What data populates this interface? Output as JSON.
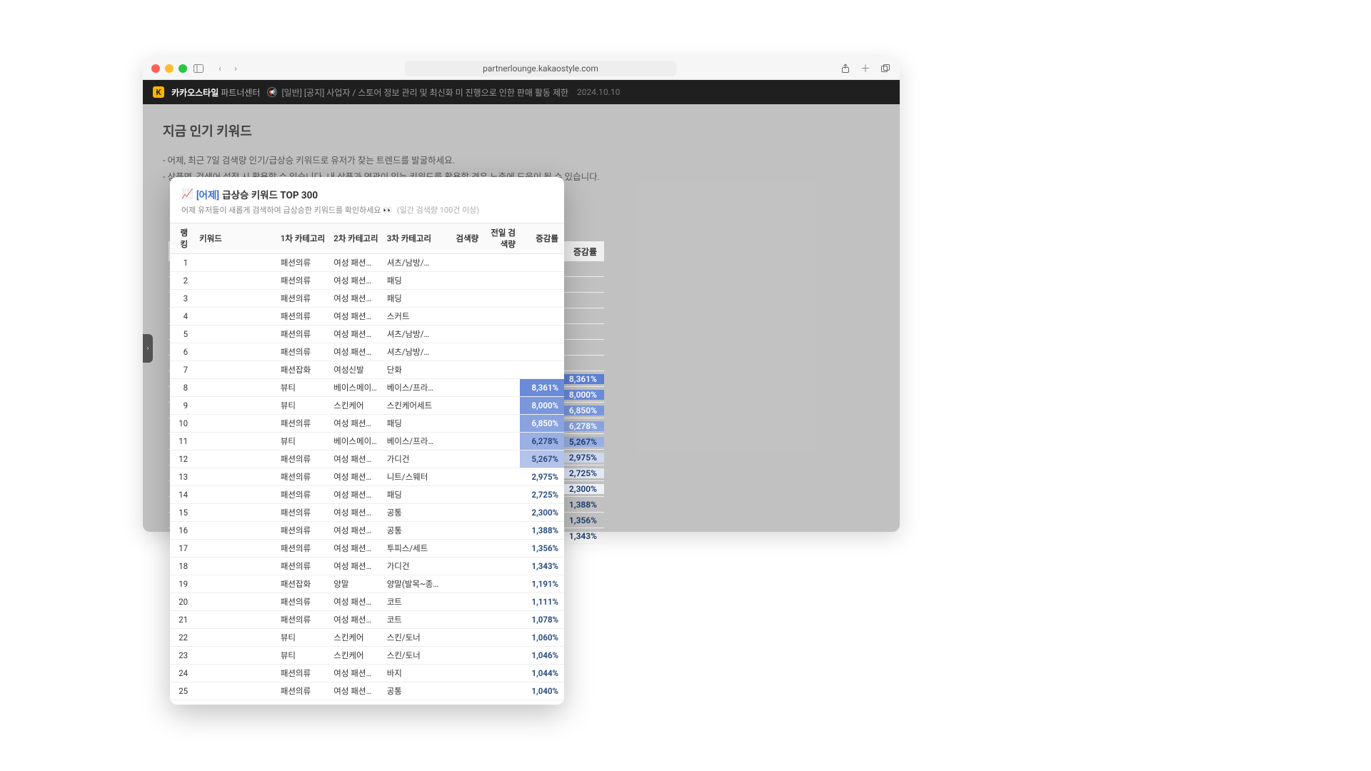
{
  "browser": {
    "url": "partnerlounge.kakaostyle.com"
  },
  "header": {
    "brand": "카카오스타일",
    "brand_sub": "파트너센터",
    "notice": "[일반] [공지] 사업자 / 스토어 정보 관리 및 최신화 미 진행으로 인한 판매 활동 제한",
    "date": "2024.10.10"
  },
  "page": {
    "title": "지금 인기 키워드",
    "help1": "- 어제, 최근 7일 검색량 인기/급상승 키워드로 유저가 찾는 트렌드를 발굴하세요.",
    "help2": "- 상품명, 검색어 설정 시 활용할 수 있습니다. 내 상품과 연관이 있는 키워드를 활용할 경우 노출에 도움이 될 수 있습니다."
  },
  "bg_table": {
    "header_change": "증감률",
    "rows": [
      {
        "pct": "8,361%",
        "cls": "pct-bg-1"
      },
      {
        "pct": "8,000%",
        "cls": "pct-bg-2"
      },
      {
        "pct": "6,850%",
        "cls": "pct-bg-3"
      },
      {
        "pct": "6,278%",
        "cls": "pct-bg-4"
      },
      {
        "pct": "5,267%",
        "cls": "pct-bg-5"
      },
      {
        "pct": "2,975%",
        "cls": "pct-bg-6"
      },
      {
        "pct": "2,725%",
        "cls": "pct-bg-7"
      },
      {
        "pct": "2,300%",
        "cls": "pct-bg-8"
      },
      {
        "pct": "1,388%",
        "cls": "pct-none"
      },
      {
        "pct": "1,356%",
        "cls": "pct-none"
      },
      {
        "pct": "1,343%",
        "cls": "pct-none"
      }
    ]
  },
  "popup": {
    "icon": "📈",
    "title_blue": "[어제]",
    "title_rest": "급상승 키워드 TOP 300",
    "subtitle": "어제 유저들이 새롭게 검색하여 급상승한 키워드를 확인하세요 👀",
    "subtitle_gray": "(일간 검색량 100건 이상)",
    "cols": {
      "rank": "랭킹",
      "keyword": "키워드",
      "cat1": "1차 카테고리",
      "cat2": "2차 카테고리",
      "cat3": "3차 카테고리",
      "search": "검색량",
      "prev": "전일 검색량",
      "change": "증감률"
    },
    "rows": [
      {
        "rank": 1,
        "cat1": "패션의류",
        "cat2": "여성 패션의류",
        "cat3": "셔츠/남방/…",
        "pct": "",
        "pcls": ""
      },
      {
        "rank": 2,
        "cat1": "패션의류",
        "cat2": "여성 패션의류",
        "cat3": "패딩",
        "pct": "",
        "pcls": ""
      },
      {
        "rank": 3,
        "cat1": "패션의류",
        "cat2": "여성 패션의류",
        "cat3": "패딩",
        "pct": "",
        "pcls": ""
      },
      {
        "rank": 4,
        "cat1": "패션의류",
        "cat2": "여성 패션의류",
        "cat3": "스커트",
        "pct": "",
        "pcls": ""
      },
      {
        "rank": 5,
        "cat1": "패션의류",
        "cat2": "여성 패션의류",
        "cat3": "셔츠/남방/…",
        "pct": "",
        "pcls": ""
      },
      {
        "rank": 6,
        "cat1": "패션의류",
        "cat2": "여성 패션의류",
        "cat3": "셔츠/남방/…",
        "pct": "",
        "pcls": ""
      },
      {
        "rank": 7,
        "cat1": "패션잡화",
        "cat2": "여성신발",
        "cat3": "단화",
        "pct": "",
        "pcls": ""
      },
      {
        "rank": 8,
        "cat1": "뷰티",
        "cat2": "베이스메이크업",
        "cat3": "베이스/프라…",
        "pct": "8,361%",
        "pcls": "pct-a1"
      },
      {
        "rank": 9,
        "cat1": "뷰티",
        "cat2": "스킨케어",
        "cat3": "스킨케어세트",
        "pct": "8,000%",
        "pcls": "pct-a2"
      },
      {
        "rank": 10,
        "cat1": "패션의류",
        "cat2": "여성 패션의류",
        "cat3": "패딩",
        "pct": "6,850%",
        "pcls": "pct-a3"
      },
      {
        "rank": 11,
        "cat1": "뷰티",
        "cat2": "베이스메이크업",
        "cat3": "베이스/프라…",
        "pct": "6,278%",
        "pcls": "pct-a4"
      },
      {
        "rank": 12,
        "cat1": "패션의류",
        "cat2": "여성 패션의류",
        "cat3": "가디건",
        "pct": "5,267%",
        "pcls": "pct-a5"
      },
      {
        "rank": 13,
        "cat1": "패션의류",
        "cat2": "여성 패션의류",
        "cat3": "니트/스웨터",
        "pct": "2,975%",
        "pcls": ""
      },
      {
        "rank": 14,
        "cat1": "패션의류",
        "cat2": "여성 패션의류",
        "cat3": "패딩",
        "pct": "2,725%",
        "pcls": ""
      },
      {
        "rank": 15,
        "cat1": "패션의류",
        "cat2": "여성 패션의류",
        "cat3": "공통",
        "pct": "2,300%",
        "pcls": ""
      },
      {
        "rank": 16,
        "cat1": "패션의류",
        "cat2": "여성 패션의류",
        "cat3": "공통",
        "pct": "1,388%",
        "pcls": ""
      },
      {
        "rank": 17,
        "cat1": "패션의류",
        "cat2": "여성 패션의류",
        "cat3": "투피스/세트",
        "pct": "1,356%",
        "pcls": ""
      },
      {
        "rank": 18,
        "cat1": "패션의류",
        "cat2": "여성 패션의류",
        "cat3": "가디건",
        "pct": "1,343%",
        "pcls": ""
      },
      {
        "rank": 19,
        "cat1": "패션잡화",
        "cat2": "양말",
        "cat3": "양말(발목~종…",
        "pct": "1,191%",
        "pcls": ""
      },
      {
        "rank": 20,
        "cat1": "패션의류",
        "cat2": "여성 패션의류",
        "cat3": "코트",
        "pct": "1,111%",
        "pcls": ""
      },
      {
        "rank": 21,
        "cat1": "패션의류",
        "cat2": "여성 패션의류",
        "cat3": "코트",
        "pct": "1,078%",
        "pcls": ""
      },
      {
        "rank": 22,
        "cat1": "뷰티",
        "cat2": "스킨케어",
        "cat3": "스킨/토너",
        "pct": "1,060%",
        "pcls": ""
      },
      {
        "rank": 23,
        "cat1": "뷰티",
        "cat2": "스킨케어",
        "cat3": "스킨/토너",
        "pct": "1,046%",
        "pcls": ""
      },
      {
        "rank": 24,
        "cat1": "패션의류",
        "cat2": "여성 패션의류",
        "cat3": "바지",
        "pct": "1,044%",
        "pcls": ""
      },
      {
        "rank": 25,
        "cat1": "패션의류",
        "cat2": "여성 패션의류",
        "cat3": "공통",
        "pct": "1,040%",
        "pcls": ""
      }
    ]
  }
}
